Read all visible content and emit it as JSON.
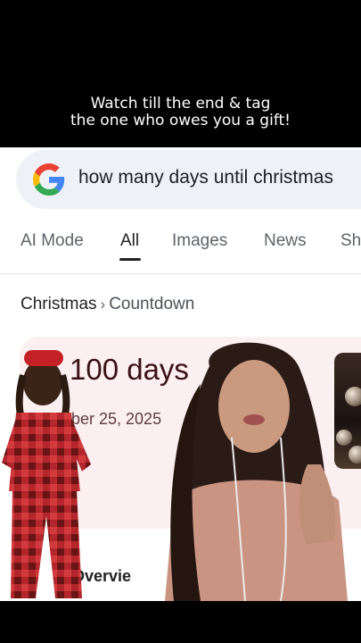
{
  "caption": {
    "line1": "Watch till the end & tag",
    "line2": "the one who owes you a gift!"
  },
  "search": {
    "query": "how many days until christmas",
    "logo_icon": "google-g-icon"
  },
  "tabs": [
    {
      "label": "AI Mode",
      "active": false
    },
    {
      "label": "All",
      "active": true
    },
    {
      "label": "Images",
      "active": false
    },
    {
      "label": "News",
      "active": false
    },
    {
      "label": "Sh",
      "active": false
    }
  ],
  "breadcrumb": {
    "topic": "Christmas",
    "separator": "›",
    "sub": "Countdown"
  },
  "countdown": {
    "days": "100 days",
    "date": "ber 25, 2025"
  },
  "ai_overview": {
    "label": "l Overvie"
  },
  "colors": {
    "card_bg": "#fbeff0",
    "search_bg": "#eef2f6",
    "accent_text": "#3a1114"
  }
}
